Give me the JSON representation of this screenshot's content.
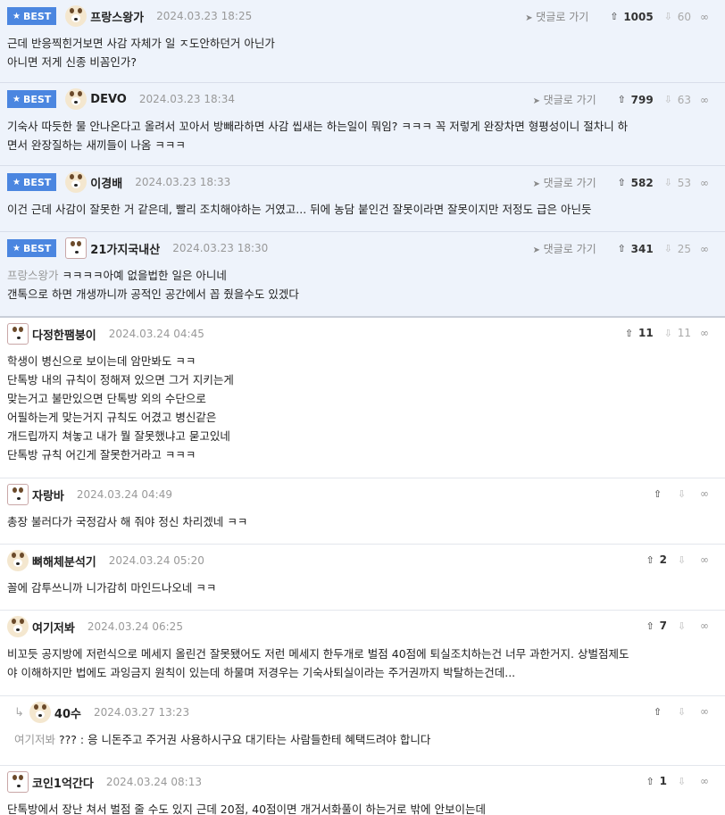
{
  "labels": {
    "best": "BEST",
    "goto": "댓글로 가기"
  },
  "comments": [
    {
      "best": true,
      "nick": "프랑스왕가",
      "date": "2024.03.23 18:25",
      "up": "1005",
      "down": "60",
      "lines": [
        "근데 반응찍힌거보면 사감 자체가 일 ㅈ도안하던거 아닌가",
        "아니면 저게 신종 비꼼인가?"
      ]
    },
    {
      "best": true,
      "nick": "DEVO",
      "date": "2024.03.23 18:34",
      "up": "799",
      "down": "63",
      "lines": [
        "기숙사 따듯한 물 안나온다고 올려서 꼬아서 방빼라하면 사감 씹새는 하는일이 뭐임? ㅋㅋㅋ 꼭 저렇게 완장차면 형평성이니 절차니 하",
        "면서 완장질하는 새끼들이 나옴 ㅋㅋㅋ"
      ]
    },
    {
      "best": true,
      "nick": "이경배",
      "date": "2024.03.23 18:33",
      "up": "582",
      "down": "53",
      "lines": [
        "이건 근데 사감이 잘못한 거 같은데, 빨리 조치해야하는 거였고... 뒤에 농담 붙인건 잘못이라면 잘못이지만 저정도 급은 아닌듯"
      ]
    },
    {
      "best": true,
      "nick": "21가지국내산",
      "date": "2024.03.23 18:30",
      "up": "341",
      "down": "25",
      "mention": "프랑스왕가",
      "lines": [
        "ㅋㅋㅋㅋ아예 없을법한 일은 아니네",
        "갠톡으로 하면 개생까니까 공적인 공간에서 꼽 줬을수도 있겠다"
      ]
    },
    {
      "best": false,
      "nick": "다정한팸붕이",
      "date": "2024.03.24 04:45",
      "up": "11",
      "down": "11",
      "lines": [
        "학생이 병신으로 보이는데 암만봐도 ㅋㅋ",
        "단톡방 내의 규칙이 정해져 있으면 그거 지키는게",
        "맞는거고 불만있으면 단톡방 외의 수단으로",
        "어필하는게 맞는거지 규칙도 어겼고 병신같은",
        "개드립까지 쳐놓고 내가 뭘 잘못했냐고 묻고있네",
        "단톡방 규칙 어긴게 잘못한거라고 ㅋㅋㅋ"
      ]
    },
    {
      "best": false,
      "nick": "자랑바",
      "date": "2024.03.24 04:49",
      "up": "",
      "down": "",
      "lines": [
        "총장 불러다가 국정감사 해 줘야 정신 차리겠네 ㅋㅋ"
      ]
    },
    {
      "best": false,
      "nick": "뼈해체분석기",
      "date": "2024.03.24 05:20",
      "up": "2",
      "down": "",
      "lines": [
        "꼴에 감투쓰니까 니가감히 마인드나오네 ㅋㅋ"
      ]
    },
    {
      "best": false,
      "nick": "여기저봐",
      "date": "2024.03.24 06:25",
      "up": "7",
      "down": "",
      "lines": [
        "비꼬듯 공지방에 저런식으로 메세지 올린건 잘못됐어도 저런 메세지 한두개로 벌점 40점에 퇴실조치하는건 너무 과한거지. 상벌점제도",
        "야 이해하지만 법에도 과잉금지 원칙이 있는데 하물며 저경우는 기숙사퇴실이라는 주거권까지 박탈하는건데..."
      ]
    },
    {
      "best": false,
      "reply": true,
      "nick": "40수",
      "date": "2024.03.27 13:23",
      "up": "",
      "down": "",
      "mention": "여기저봐",
      "lines": [
        "??? : 응 니돈주고 주거권 사용하시구요 대기타는 사람들한테 혜택드려야 합니다"
      ]
    },
    {
      "best": false,
      "nick": "코인1억간다",
      "date": "2024.03.24 08:13",
      "up": "1",
      "down": "",
      "lines": [
        "단톡방에서 장난 쳐서 벌점 줄 수도 있지 근데 20점, 40점이면 개거서화풀이 하는거로 밖에 안보이는데"
      ]
    }
  ]
}
